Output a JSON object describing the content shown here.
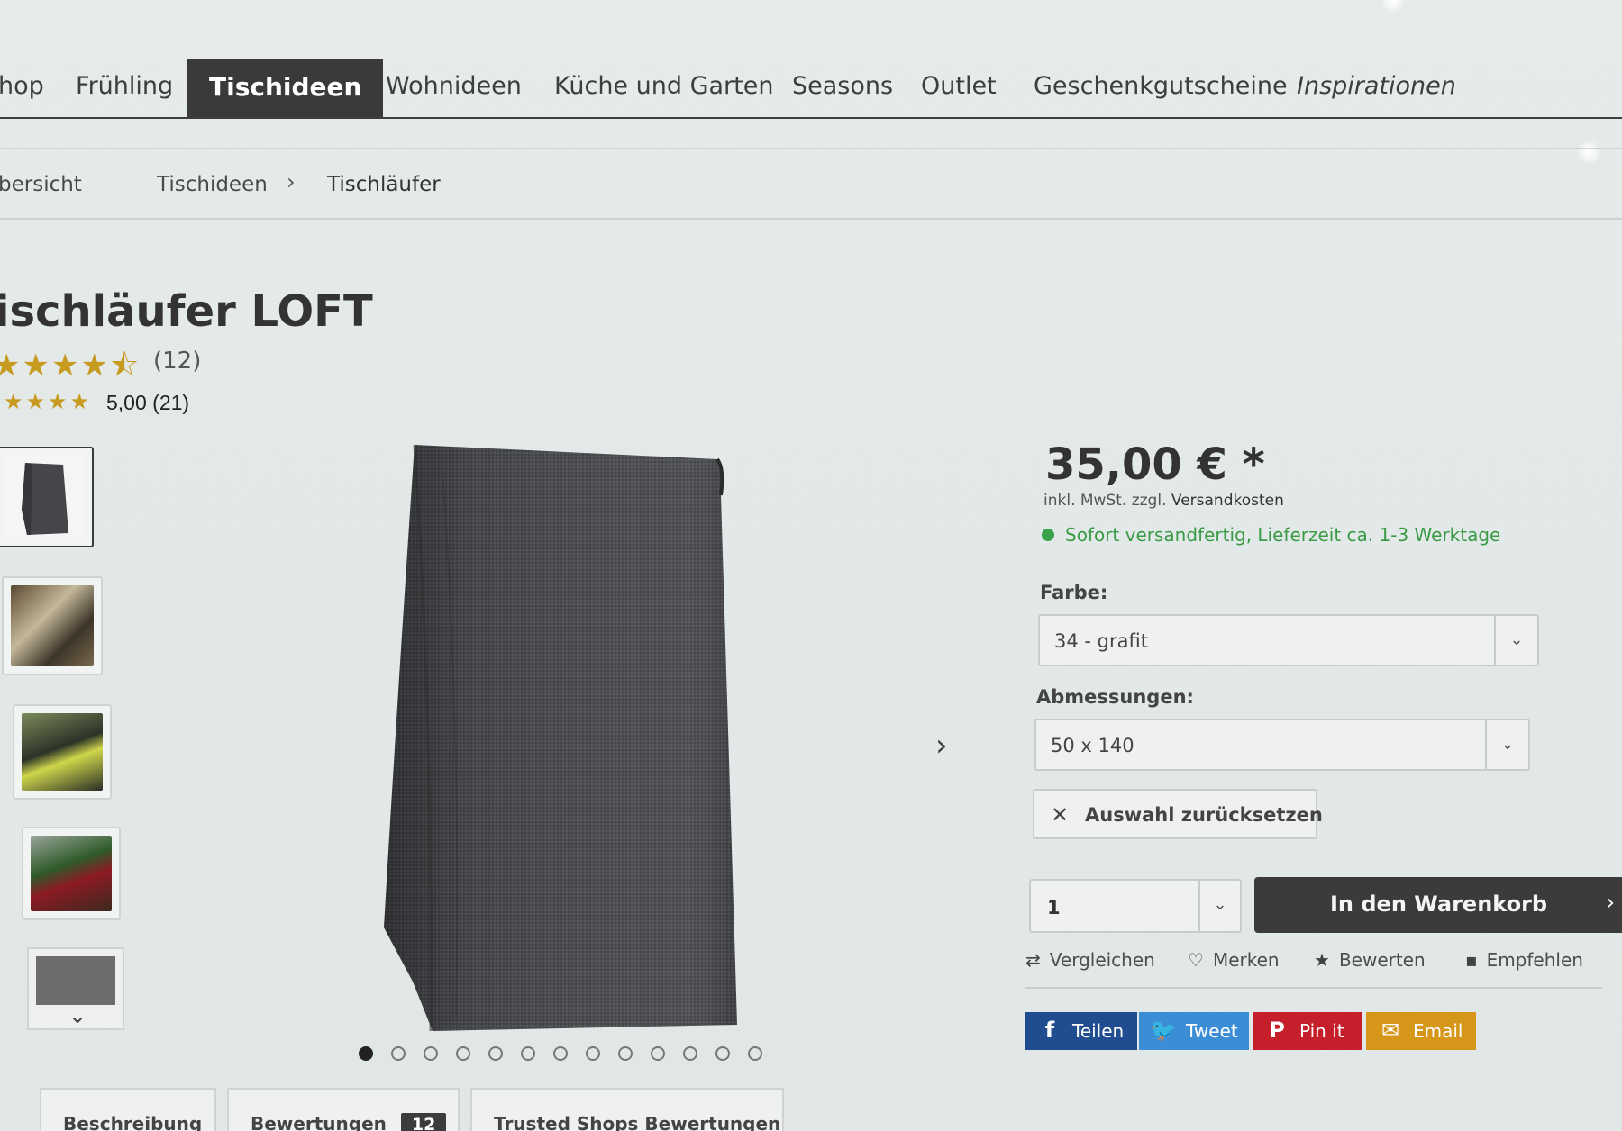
{
  "nav": {
    "items": [
      {
        "label": "hop"
      },
      {
        "label": "Frühling"
      },
      {
        "label": "Tischideen"
      },
      {
        "label": "Wohnideen"
      },
      {
        "label": "Küche und Garten"
      },
      {
        "label": "Seasons"
      },
      {
        "label": "Outlet"
      },
      {
        "label": "Geschenkgutscheine"
      },
      {
        "label": "Inspirationen"
      }
    ],
    "active": "Tischideen"
  },
  "breadcrumb": {
    "items": [
      "bersicht",
      "Tischideen",
      "Tischläufer"
    ],
    "separator": "›"
  },
  "product": {
    "title": "ischläufer LOFT",
    "rating_stars": "★★★★⯪",
    "rating_count": "(12)",
    "trusted_stars": "★★★★",
    "trusted_score": "5,00 (21)",
    "image_colors": {
      "fabric": "#4a4b4d",
      "fabric_dark": "#3a3b3d",
      "fabric_light": "#5a5b5d"
    }
  },
  "gallery": {
    "thumbnails": [
      "runner-grafit-icon",
      "table-setting-1-icon",
      "table-setting-2-icon",
      "table-setting-3-icon"
    ],
    "more_icon": "chevron-down-icon",
    "next_icon": "chevron-right-icon",
    "dot_count": 13,
    "active_dot": 0
  },
  "tabs": [
    {
      "label": "Beschreibung"
    },
    {
      "label": "Bewertungen",
      "badge": "12"
    },
    {
      "label": "Trusted Shops Bewertungen"
    }
  ],
  "buybox": {
    "price": "35,00 € *",
    "tax_prefix": "inkl. MwSt. zzgl.",
    "tax_link": "Versandkosten",
    "stock_text": "Sofort versandfertig, Lieferzeit ca. 1-3 Werktage",
    "stock_color": "#3aa24a",
    "color_label": "Farbe:",
    "color_value": "34 - grafit",
    "size_label": "Abmessungen:",
    "size_value": "50 x 140",
    "reset_label": "Auswahl zurücksetzen",
    "qty_value": "1",
    "cart_label": "In den Warenkorb",
    "actions": [
      {
        "label": "Vergleichen",
        "icon": "⇄"
      },
      {
        "label": "Merken",
        "icon": "♡"
      },
      {
        "label": "Bewerten",
        "icon": "★"
      },
      {
        "label": "Empfehlen",
        "icon": "▪"
      }
    ],
    "share": [
      {
        "label": "Teilen",
        "icon": "f",
        "color": "#1f4d8f"
      },
      {
        "label": "Tweet",
        "icon": "🐦",
        "color": "#3b8ed6"
      },
      {
        "label": "Pin it",
        "icon": "P",
        "color": "#c41f2a"
      },
      {
        "label": "Email",
        "icon": "✉",
        "color": "#d6961a"
      }
    ]
  }
}
